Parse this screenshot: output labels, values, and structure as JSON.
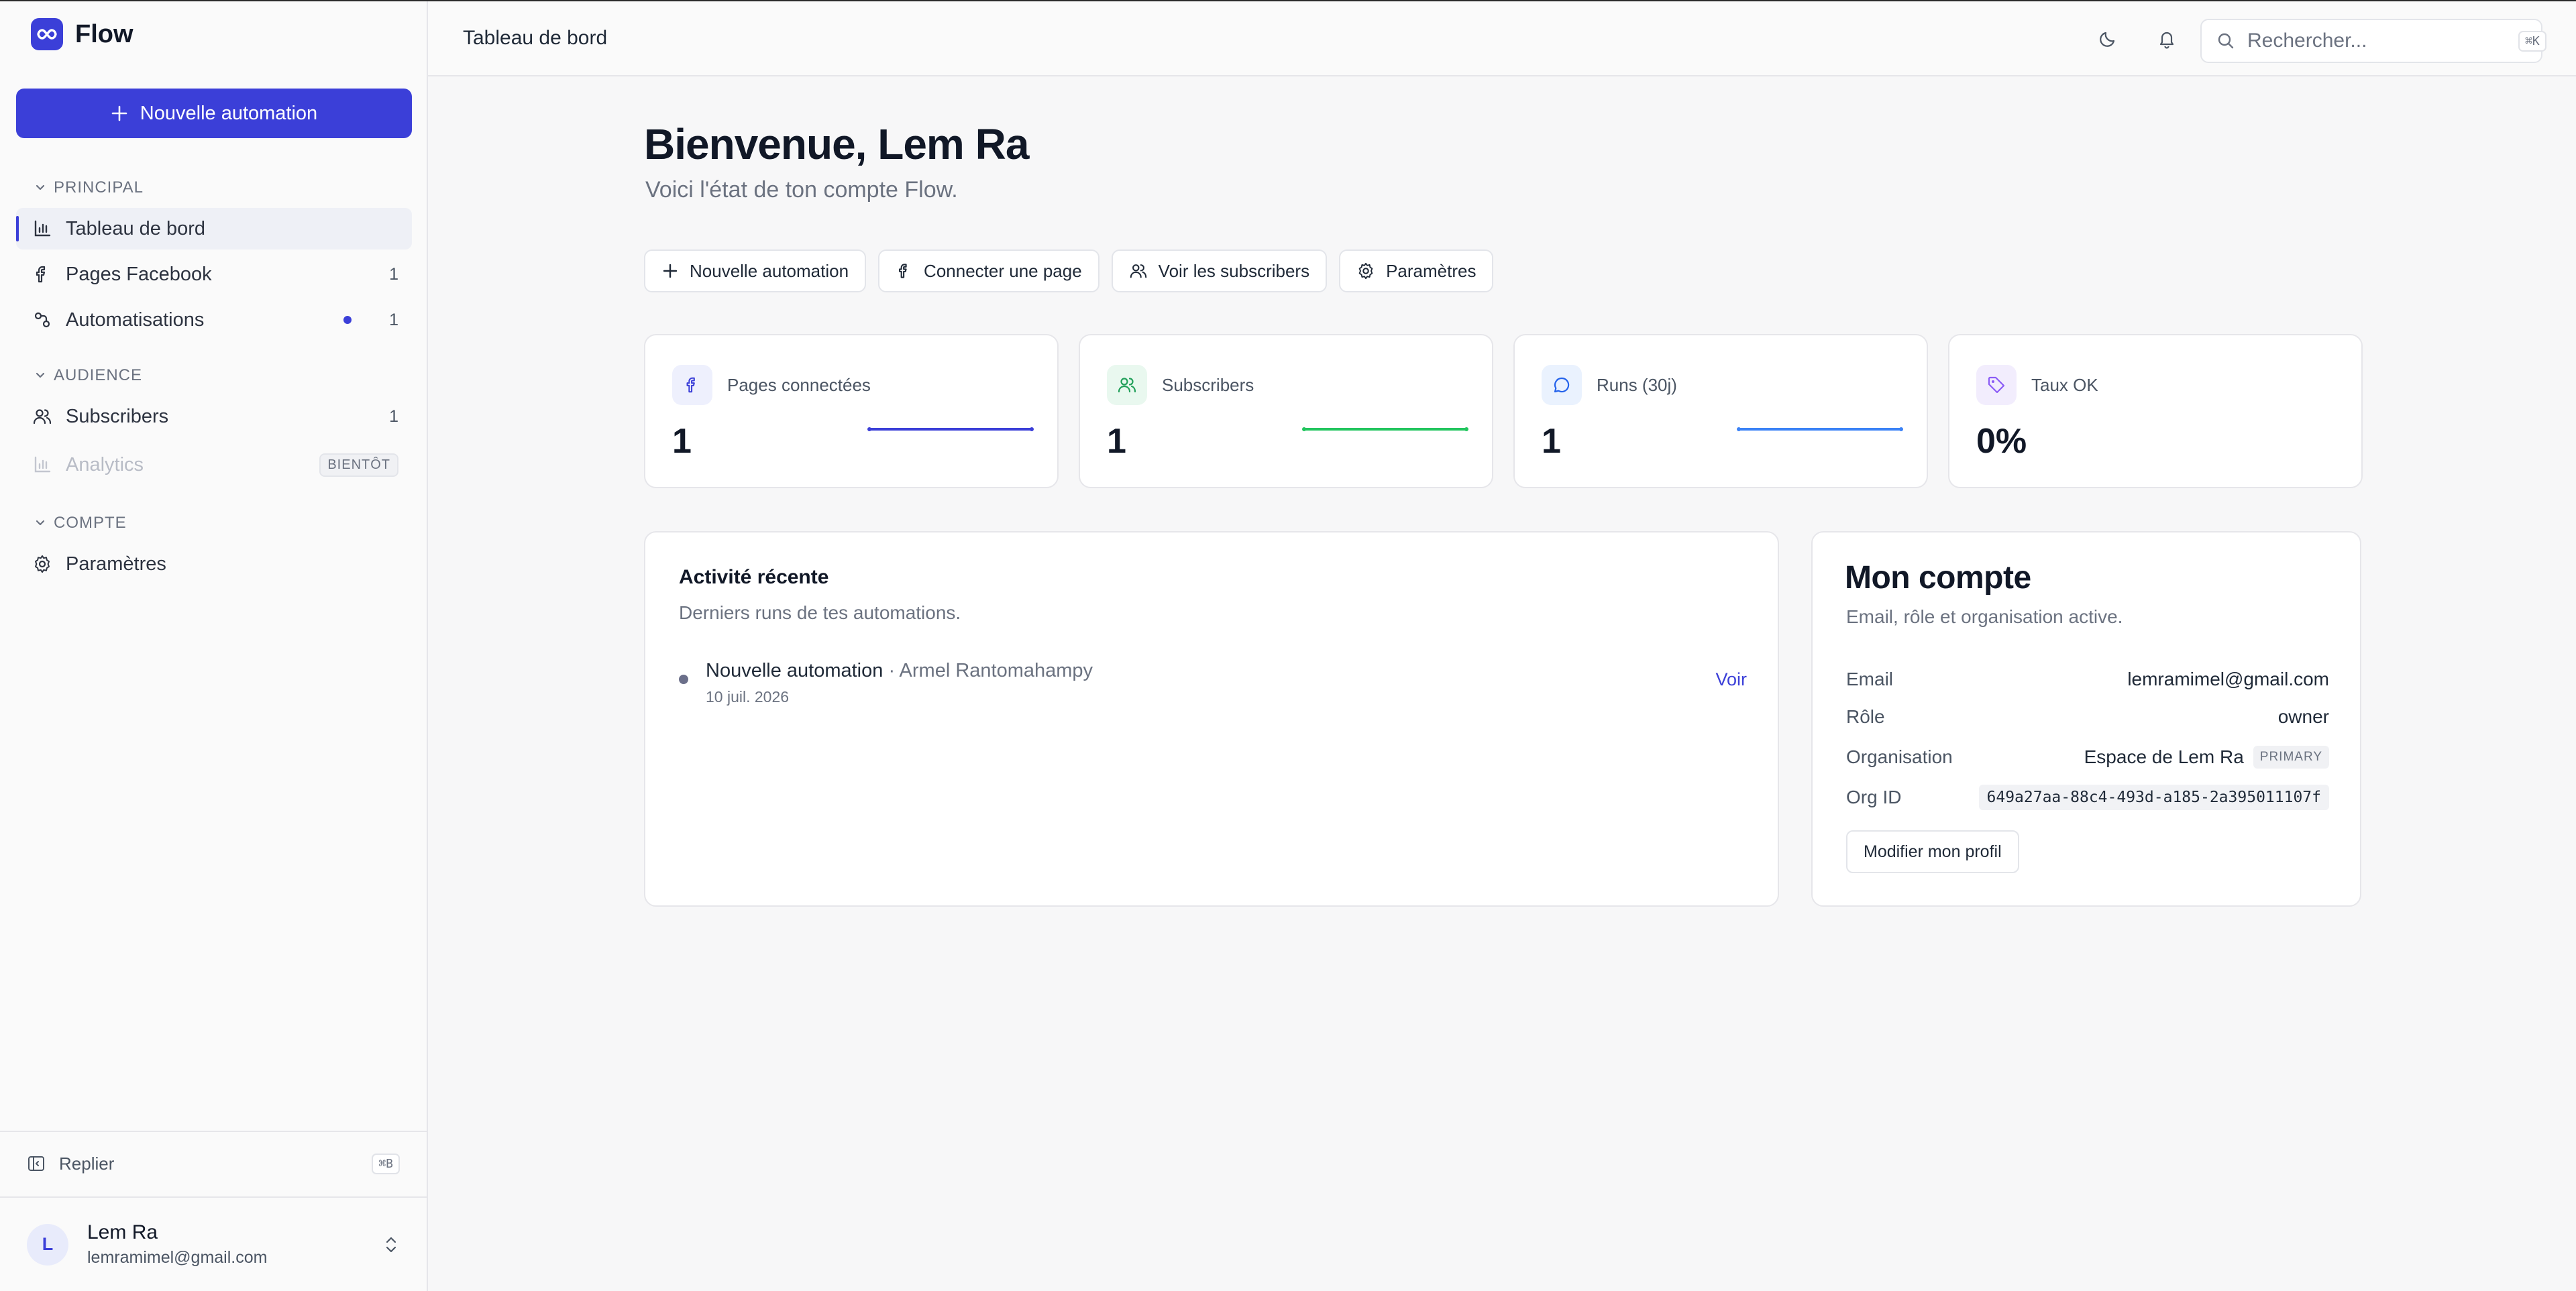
{
  "app": {
    "name": "Flow",
    "logo_icon": "infinity-icon",
    "accent": "#3b3fd8"
  },
  "sidebar": {
    "new_button_label": "Nouvelle automation",
    "sections": {
      "principal": "PRINCIPAL",
      "audience": "AUDIENCE",
      "compte": "COMPTE"
    },
    "items": [
      {
        "label": "Tableau de bord",
        "icon": "bar-chart-icon",
        "active": true
      },
      {
        "label": "Pages Facebook",
        "icon": "facebook-icon",
        "count": "1"
      },
      {
        "label": "Automatisations",
        "icon": "workflow-icon",
        "count": "1",
        "dot": true
      },
      {
        "label": "Subscribers",
        "icon": "users-icon",
        "count": "1"
      },
      {
        "label": "Analytics",
        "icon": "bar-chart-icon",
        "badge": "BIENTÔT",
        "disabled": true
      },
      {
        "label": "Paramètres",
        "icon": "gear-icon"
      }
    ],
    "collapse": {
      "label": "Replier",
      "shortcut": "⌘B"
    },
    "user": {
      "initial": "L",
      "name": "Lem Ra",
      "email": "lemramimel@gmail.com"
    }
  },
  "topbar": {
    "breadcrumb": "Tableau de bord",
    "search": {
      "placeholder": "Rechercher...",
      "shortcut": "⌘K"
    }
  },
  "main": {
    "title": "Bienvenue, Lem Ra",
    "subtitle": "Voici l'état de ton compte Flow.",
    "quick_actions": [
      {
        "label": "Nouvelle automation",
        "icon": "plus-icon"
      },
      {
        "label": "Connecter une page",
        "icon": "facebook-icon"
      },
      {
        "label": "Voir les subscribers",
        "icon": "users-icon"
      },
      {
        "label": "Paramètres",
        "icon": "gear-icon"
      }
    ],
    "stats": [
      {
        "label": "Pages connectées",
        "value": "1",
        "icon": "facebook-icon",
        "color": "#3b3fd8",
        "bg": "#eef0fd"
      },
      {
        "label": "Subscribers",
        "value": "1",
        "icon": "users-icon",
        "color": "#22c55e",
        "bg": "#e9f8ef"
      },
      {
        "label": "Runs (30j)",
        "value": "1",
        "icon": "message-circle-icon",
        "color": "#3b82f6",
        "bg": "#eaf2fe"
      },
      {
        "label": "Taux OK",
        "value": "0%",
        "icon": "tag-icon",
        "color": "#8b5cf6",
        "bg": "#f2edfd"
      }
    ],
    "activity": {
      "title": "Activité récente",
      "subtitle": "Derniers runs de tes automations.",
      "items": [
        {
          "name": "Nouvelle automation",
          "who": " · Armel Rantomahampy",
          "date": "10 juil. 2026",
          "action": "Voir"
        }
      ]
    },
    "account": {
      "title": "Mon compte",
      "subtitle": "Email, rôle et organisation active.",
      "rows": {
        "email": {
          "key": "Email",
          "value": "lemramimel@gmail.com"
        },
        "role": {
          "key": "Rôle",
          "value": "owner"
        },
        "org": {
          "key": "Organisation",
          "value": "Espace de Lem Ra",
          "badge": "PRIMARY"
        },
        "org_id": {
          "key": "Org ID",
          "value": "649a27aa-88c4-493d-a185-2a395011107f"
        }
      },
      "edit_button": "Modifier mon profil"
    }
  }
}
